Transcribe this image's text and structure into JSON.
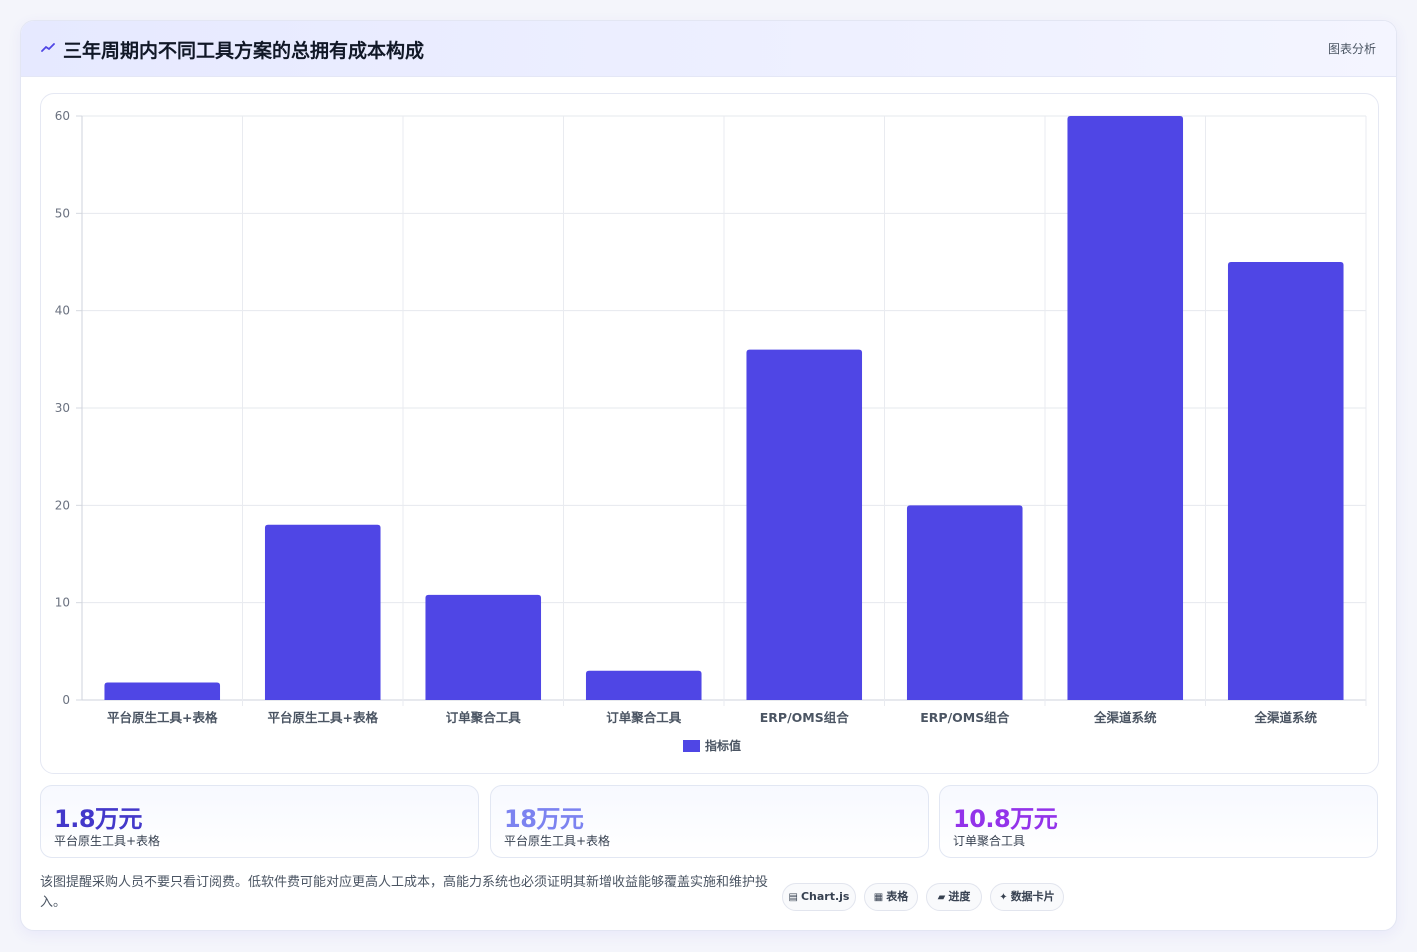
{
  "header": {
    "title": "三年周期内不同工具方案的总拥有成本构成",
    "tag": "图表分析",
    "icon": "trend-icon"
  },
  "chart_data": {
    "type": "bar",
    "categories": [
      "平台原生工具+表格",
      "平台原生工具+表格",
      "订单聚合工具",
      "订单聚合工具",
      "ERP/OMS组合",
      "ERP/OMS组合",
      "全渠道系统",
      "全渠道系统"
    ],
    "series": [
      {
        "name": "指标值",
        "values": [
          1.8,
          18,
          10.8,
          3,
          36,
          20,
          60,
          45
        ],
        "color": "#4f46e5"
      }
    ],
    "yticks": [
      0,
      10,
      20,
      30,
      40,
      50,
      60
    ],
    "ylim": [
      0,
      60
    ],
    "grid": true,
    "legend_position": "bottom"
  },
  "stats": [
    {
      "value": "1.8万元",
      "label": "平台原生工具+表格",
      "color": "#4338ca"
    },
    {
      "value": "18万元",
      "label": "平台原生工具+表格",
      "color": "#7c83f0"
    },
    {
      "value": "10.8万元",
      "label": "订单聚合工具",
      "color": "#9333ea"
    }
  ],
  "footer": {
    "note": "该图提醒采购人员不要只看订阅费。低软件费可能对应更高人工成本，高能力系统也必须证明其新增收益能够覆盖实施和维护投入。",
    "chips": [
      {
        "icon": "chart-icon",
        "glyph": "▤",
        "label": "Chart.js"
      },
      {
        "icon": "table-icon",
        "glyph": "▦",
        "label": "表格"
      },
      {
        "icon": "progress-icon",
        "glyph": "▰",
        "label": "进度"
      },
      {
        "icon": "sparkle-icon",
        "glyph": "✦",
        "label": "数据卡片"
      }
    ]
  }
}
